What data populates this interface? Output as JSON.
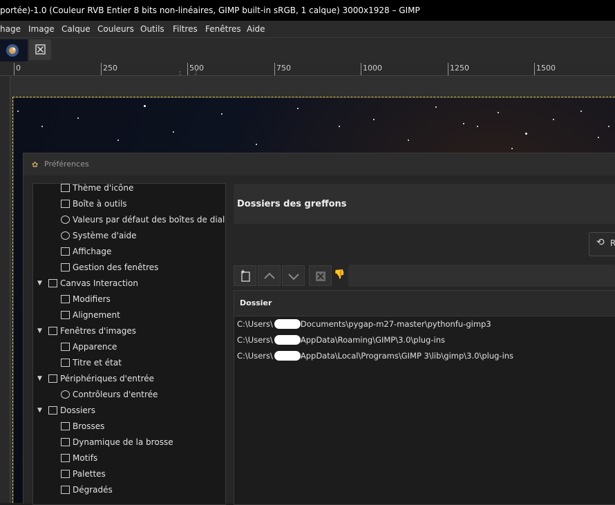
{
  "window": {
    "title": "portée)-1.0 (Couleur RVB Entier 8 bits non-linéaires, GIMP built-in sRGB, 1 calque) 3000x1928 – GIMP"
  },
  "menubar": {
    "items": [
      "hage",
      "Image",
      "Calque",
      "Couleurs",
      "Outils",
      "Filtres",
      "Fenêtres",
      "Aide"
    ]
  },
  "ruler": {
    "labels": [
      "0",
      "250",
      "500",
      "750",
      "1000",
      "1250",
      "1500"
    ]
  },
  "dialog": {
    "title": "Préférences",
    "tree": [
      {
        "label": "Thème d'icône",
        "level": 1,
        "icon": "icon-theme-icon"
      },
      {
        "label": "Boîte à outils",
        "level": 1,
        "icon": "toolbox-icon"
      },
      {
        "label": "Valeurs par défaut des boîtes de dialogue",
        "level": 1,
        "icon": "dialog-defaults-icon"
      },
      {
        "label": "Système d'aide",
        "level": 1,
        "icon": "help-system-icon"
      },
      {
        "label": "Affichage",
        "level": 1,
        "icon": "display-icon"
      },
      {
        "label": "Gestion des fenêtres",
        "level": 1,
        "icon": "window-management-icon"
      },
      {
        "label": "Canvas Interaction",
        "level": 0,
        "expanded": true,
        "icon": "canvas-icon"
      },
      {
        "label": "Modifiers",
        "level": 1,
        "icon": "modifiers-icon"
      },
      {
        "label": "Alignement",
        "level": 1,
        "icon": "alignment-icon"
      },
      {
        "label": "Fenêtres d'images",
        "level": 0,
        "expanded": true,
        "icon": "image-window-icon"
      },
      {
        "label": "Apparence",
        "level": 1,
        "icon": "appearance-icon"
      },
      {
        "label": "Titre et état",
        "level": 1,
        "icon": "title-status-icon"
      },
      {
        "label": "Périphériques d'entrée",
        "level": 0,
        "expanded": true,
        "icon": "input-devices-icon"
      },
      {
        "label": "Contrôleurs d'entrée",
        "level": 1,
        "icon": "input-controllers-icon"
      },
      {
        "label": "Dossiers",
        "level": 0,
        "expanded": true,
        "icon": "folders-icon"
      },
      {
        "label": "Brosses",
        "level": 1,
        "icon": "brushes-icon"
      },
      {
        "label": "Dynamique de la brosse",
        "level": 1,
        "icon": "brush-dynamics-icon"
      },
      {
        "label": "Motifs",
        "level": 1,
        "icon": "patterns-icon"
      },
      {
        "label": "Palettes",
        "level": 1,
        "icon": "palettes-icon"
      },
      {
        "label": "Dégradés",
        "level": 1,
        "icon": "gradients-icon"
      }
    ],
    "panel": {
      "title": "Dossiers des greffons",
      "reset_label": "R",
      "column_header": "Dossier",
      "paths": [
        {
          "prefix": "C:\\Users\\",
          "suffix": "Documents\\pygap-m27-master\\pythonfu-gimp3"
        },
        {
          "prefix": "C:\\Users\\",
          "suffix": "AppData\\Roaming\\GIMP\\3.0\\plug-ins"
        },
        {
          "prefix": "C:\\Users\\",
          "suffix": "AppData\\Local\\Programs\\GIMP 3\\lib\\gimp\\3.0\\plug-ins"
        }
      ]
    }
  }
}
